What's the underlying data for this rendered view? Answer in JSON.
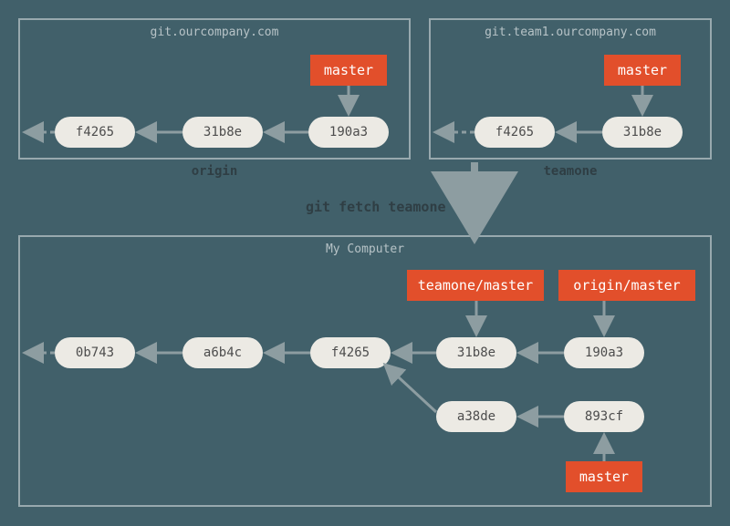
{
  "origin": {
    "host": "git.ourcompany.com",
    "label": "origin",
    "branch_master": "master",
    "commits": {
      "c0": "f4265",
      "c1": "31b8e",
      "c2": "190a3"
    }
  },
  "teamone": {
    "host": "git.team1.ourcompany.com",
    "label": "teamone",
    "branch_master": "master",
    "commits": {
      "c0": "f4265",
      "c1": "31b8e"
    }
  },
  "command": "git fetch teamone",
  "local": {
    "title": "My Computer",
    "branches": {
      "teamone_master": "teamone/master",
      "origin_master": "origin/master",
      "master": "master"
    },
    "commits": {
      "c0": "0b743",
      "c1": "a6b4c",
      "c2": "f4265",
      "c3": "31b8e",
      "c4": "190a3",
      "c5": "a38de",
      "c6": "893cf"
    }
  }
}
